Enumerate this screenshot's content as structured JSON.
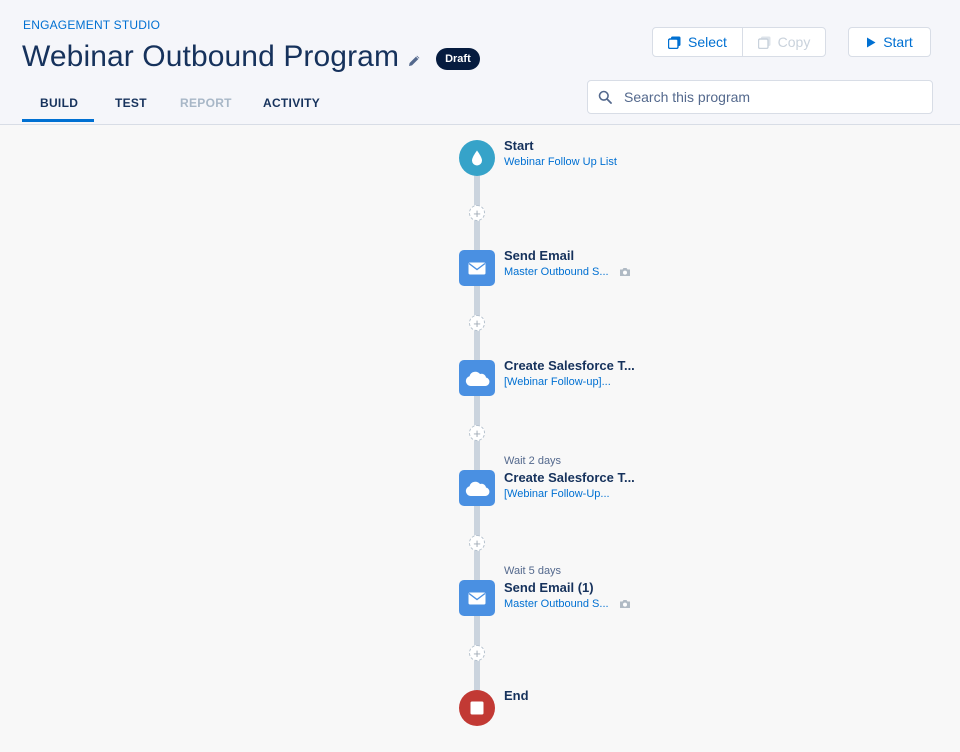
{
  "header": {
    "studio_label": "ENGAGEMENT STUDIO",
    "title": "Webinar Outbound Program",
    "status_badge": "Draft",
    "tabs": [
      {
        "label": "BUILD",
        "state": "active"
      },
      {
        "label": "TEST",
        "state": "normal"
      },
      {
        "label": "REPORT",
        "state": "disabled"
      },
      {
        "label": "ACTIVITY",
        "state": "normal"
      }
    ],
    "buttons": {
      "select_label": "Select",
      "copy_label": "Copy",
      "start_label": "Start"
    },
    "search": {
      "placeholder": "Search this program",
      "value": ""
    }
  },
  "flow": {
    "steps": [
      {
        "type": "start",
        "icon": "water-drop-icon",
        "title": "Start",
        "subtitle": "Webinar Follow Up List",
        "wait": ""
      },
      {
        "type": "send-email",
        "icon": "envelope-icon",
        "title": "Send Email",
        "subtitle": "Master Outbound S...",
        "wait": "",
        "has_camera": true
      },
      {
        "type": "salesforce-task",
        "icon": "salesforce-cloud-icon",
        "title": "Create Salesforce T...",
        "subtitle": "[Webinar Follow-up]...",
        "wait": ""
      },
      {
        "type": "salesforce-task",
        "icon": "salesforce-cloud-icon",
        "title": "Create Salesforce T...",
        "subtitle": "[Webinar Follow-Up...",
        "wait": "Wait 2 days"
      },
      {
        "type": "send-email",
        "icon": "envelope-icon",
        "title": "Send Email (1)",
        "subtitle": "Master Outbound S...",
        "wait": "Wait 5 days",
        "has_camera": true
      },
      {
        "type": "end",
        "icon": "stop-icon",
        "title": "End",
        "subtitle": "",
        "wait": ""
      }
    ]
  },
  "colors": {
    "accent": "#0070d2",
    "start_node": "#36a3c9",
    "action_node": "#4a90e2",
    "end_node": "#c23934",
    "badge_bg": "#061c3f"
  }
}
